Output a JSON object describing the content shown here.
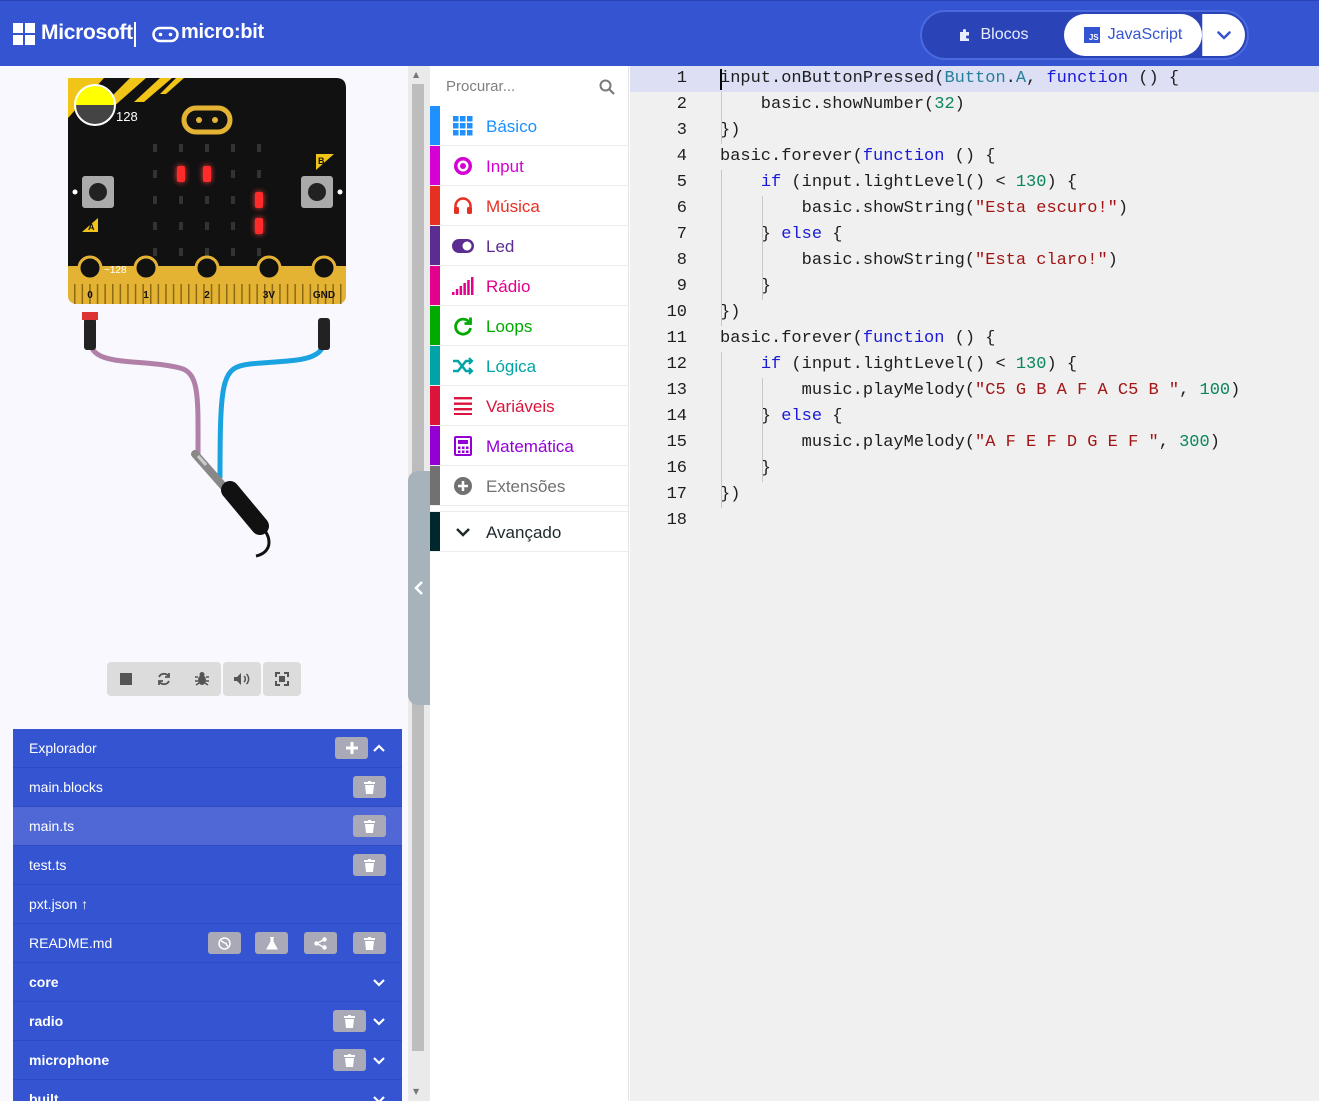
{
  "header": {
    "microsoft_label": "Microsoft",
    "microbit_label": "micro:bit",
    "toggle": {
      "blocks_label": "Blocos",
      "javascript_label": "JavaScript",
      "js_badge": "JS"
    },
    "colors": {
      "brand": "#3454D1"
    }
  },
  "simulator": {
    "light_level": "128",
    "pin0_value": "~128",
    "button_a": "A",
    "button_b": "B",
    "pins": [
      "0",
      "1",
      "2",
      "3V",
      "GND"
    ],
    "leds_on": [
      [
        1,
        1
      ],
      [
        1,
        2
      ],
      [
        2,
        4
      ],
      [
        3,
        4
      ]
    ],
    "controls": [
      "stop-icon",
      "restart-icon",
      "debug-icon",
      "mute-icon",
      "fullscreen-icon"
    ]
  },
  "explorer": {
    "title": "Explorador",
    "files": [
      {
        "name": "main.blocks",
        "active": false
      },
      {
        "name": "main.ts",
        "active": true
      },
      {
        "name": "test.ts",
        "active": false
      },
      {
        "name": "pxt.json ↑",
        "active": false
      },
      {
        "name": "README.md",
        "active": false
      }
    ],
    "packages": [
      "core",
      "radio",
      "microphone",
      "built"
    ]
  },
  "toolbox": {
    "search_placeholder": "Procurar...",
    "categories": [
      {
        "label": "Básico",
        "color": "#1E90FF",
        "icon": "grid-icon"
      },
      {
        "label": "Input",
        "color": "#D400D4",
        "icon": "target-icon"
      },
      {
        "label": "Música",
        "color": "#E63022",
        "icon": "headphones-icon"
      },
      {
        "label": "Led",
        "color": "#5C2D91",
        "icon": "toggle-icon"
      },
      {
        "label": "Rádio",
        "color": "#E3008C",
        "icon": "signal-bars-icon"
      },
      {
        "label": "Loops",
        "color": "#00AA00",
        "icon": "loop-icon"
      },
      {
        "label": "Lógica",
        "color": "#00A4A6",
        "icon": "shuffle-icon"
      },
      {
        "label": "Variáveis",
        "color": "#DC143C",
        "icon": "list-icon"
      },
      {
        "label": "Matemática",
        "color": "#9400D3",
        "icon": "calculator-icon"
      },
      {
        "label": "Extensões",
        "color": "#717171",
        "icon": "plus-circle-icon"
      }
    ],
    "advanced_label": "Avançado"
  },
  "editor": {
    "lines": [
      "input.onButtonPressed(Button.A, function () {",
      "    basic.showNumber(32)",
      "})",
      "basic.forever(function () {",
      "    if (input.lightLevel() < 130) {",
      "        basic.showString(\"Esta escuro!\")",
      "    } else {",
      "        basic.showString(\"Esta claro!\")",
      "    }",
      "})",
      "basic.forever(function () {",
      "    if (input.lightLevel() < 130) {",
      "        music.playMelody(\"C5 G B A F A C5 B \", 100)",
      "    } else {",
      "        music.playMelody(\"A F E F D G E F \", 300)",
      "    }",
      "})",
      ""
    ],
    "current_line": 1
  }
}
